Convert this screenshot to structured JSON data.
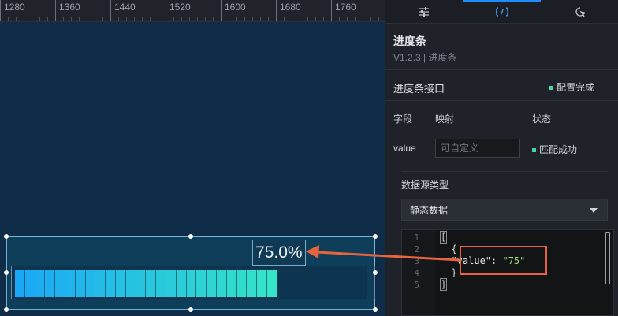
{
  "ruler": {
    "ticks": [
      "1280",
      "1360",
      "1440",
      "1520",
      "1600",
      "1680",
      "1760"
    ]
  },
  "widget": {
    "percent_label": "75.0%",
    "progress_fraction": 0.75,
    "segments": 26,
    "bar_color_start": "#1aa8f5",
    "bar_color_end": "#35e3c8"
  },
  "panel": {
    "tabs": [
      {
        "name": "style",
        "icon": "sliders-icon"
      },
      {
        "name": "data",
        "icon": "code-icon"
      },
      {
        "name": "interaction",
        "icon": "interaction-icon"
      }
    ],
    "component_title": "进度条",
    "component_version": "V1.2.3 | 进度条",
    "interface_title": "进度条接口",
    "interface_status": "配置完成",
    "columns": {
      "field": "字段",
      "mapping": "映射",
      "status": "状态"
    },
    "row": {
      "field": "value",
      "mapping_placeholder": "可自定义",
      "status": "匹配成功"
    },
    "data_source_label": "数据源类型",
    "data_source_value": "静态数据",
    "editor": {
      "line_numbers": [
        "1",
        "2",
        "3",
        "4",
        "5"
      ],
      "line1": "[",
      "line2": "  {",
      "key": "\"value\"",
      "colon": ": ",
      "value": "\"75\"",
      "line4": "  }",
      "line5": "]"
    },
    "accent_color": "#1f8bff",
    "success_color": "#4fd4a4",
    "annotation_color": "#e8643c"
  }
}
